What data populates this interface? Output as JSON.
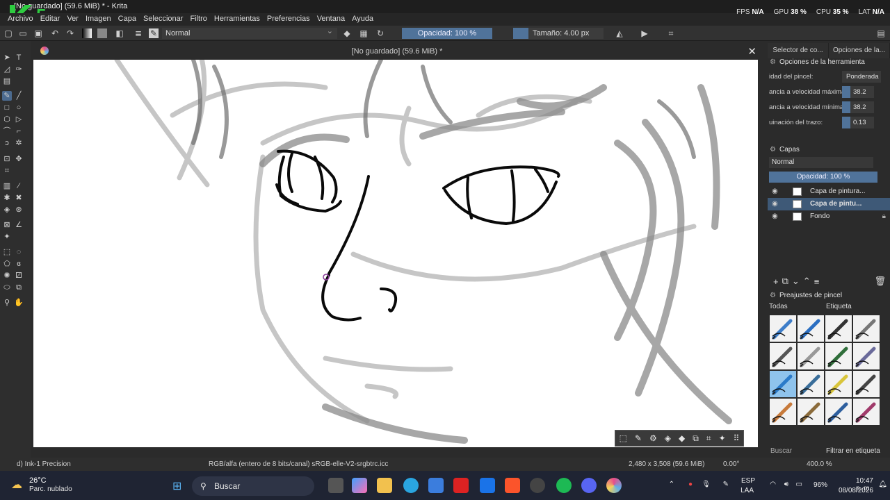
{
  "window": {
    "title": "[No guardado] (59.6 MiB) * - Krita"
  },
  "menu": [
    "Archivo",
    "Editar",
    "Ver",
    "Imagen",
    "Capa",
    "Seleccionar",
    "Filtro",
    "Herramientas",
    "Preferencias",
    "Ventana",
    "Ayuda"
  ],
  "perf": {
    "fps_label": "FPS",
    "fps": "N/A",
    "gpu_label": "GPU",
    "gpu": "38 %",
    "cpu_label": "CPU",
    "cpu": "35 %",
    "lat_label": "LAT",
    "lat": "N/A"
  },
  "toolbar": {
    "blend_mode": "Normal",
    "opacity": "Opacidad: 100 %",
    "size": "Tamaño: 4.00 px"
  },
  "document": {
    "tab_title": "[No guardado]  (59.6 MiB) *"
  },
  "right_panel": {
    "tabs": [
      "Selector de co...",
      "Opciones de la..."
    ],
    "tool_options_title": "Opciones de la herramienta",
    "options": [
      {
        "label": "idad del pincel:",
        "value": "Ponderada"
      },
      {
        "label": "ancia a velocidad máxima:",
        "value": "38.2"
      },
      {
        "label": "ancia a velocidad mínima:",
        "value": "38.2"
      },
      {
        "label": "uinación del trazo:",
        "value": "0.13"
      }
    ],
    "layers_title": "Capas",
    "layer_blend": "Normal",
    "layer_opacity": "Opacidad: 100 %",
    "layers": [
      {
        "name": "Capa de pintura..."
      },
      {
        "name": "Capa de pintu..."
      },
      {
        "name": "Fondo"
      }
    ],
    "presets_title": "Preajustes de pincel",
    "preset_filter": "Todas",
    "preset_tag": "Etiqueta",
    "preset_search": "Buscar",
    "filter_tag": "Filtrar en etiqueta"
  },
  "status": {
    "brush": "d) Ink-1 Precision",
    "color_space": "RGB/alfa (entero de 8 bits/canal)  sRGB-elle-V2-srgbtrc.icc",
    "dimensions": "2,480 x 3,508 (59.6 MiB)",
    "rotation": "0.00°",
    "zoom": "400.0 %"
  },
  "taskbar": {
    "temp": "26°C",
    "weather": "Parc. nublado",
    "search": "Buscar",
    "lang1": "ESP",
    "lang2": "LAA",
    "battery": "96%",
    "time": "10:47 p. m.",
    "date": "08/08/2026"
  },
  "colors": {
    "accent": "#50739a",
    "panel": "#2b2b2b",
    "canvas": "#ffffff",
    "taskbar": "#1f2433"
  }
}
